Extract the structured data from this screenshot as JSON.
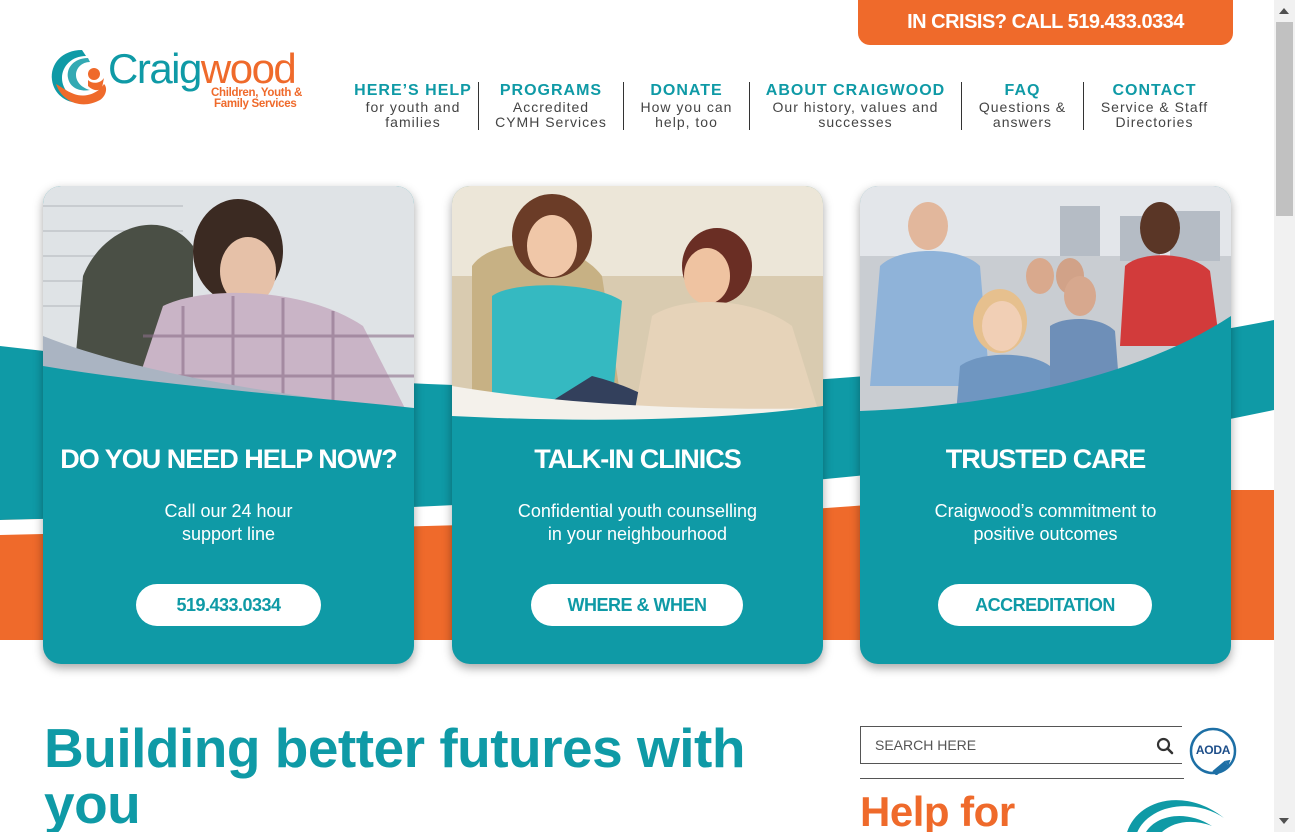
{
  "crisis": {
    "label": "IN CRISIS? CALL 519.433.0334"
  },
  "logo": {
    "word_a": "Craig",
    "word_b": "wood",
    "sub_line1": "Children, Youth &",
    "sub_line2": "Family Services"
  },
  "nav": [
    {
      "title": "HERE’S HELP",
      "sub1": "for youth and",
      "sub2": "families"
    },
    {
      "title": "PROGRAMS",
      "sub1": "Accredited",
      "sub2": "CYMH Services"
    },
    {
      "title": "DONATE",
      "sub1": "How you can",
      "sub2": "help, too"
    },
    {
      "title": "ABOUT CRAIGWOOD",
      "sub1": "Our history, values and",
      "sub2": "successes"
    },
    {
      "title": "FAQ",
      "sub1": "Questions &",
      "sub2": "answers"
    },
    {
      "title": "CONTACT",
      "sub1": "Service & Staff",
      "sub2": "Directories"
    }
  ],
  "cards": [
    {
      "title": "DO YOU NEED HELP NOW?",
      "line1": "Call our 24 hour",
      "line2": "support line",
      "button": "519.433.0334"
    },
    {
      "title": "TALK-IN CLINICS",
      "line1": "Confidential youth counselling",
      "line2": "in your neighbourhood",
      "button": "WHERE & WHEN"
    },
    {
      "title": "TRUSTED CARE",
      "line1": "Craigwood’s commitment to",
      "line2": "positive outcomes",
      "button": "ACCREDITATION"
    }
  ],
  "headline": {
    "line1": "Building better futures with",
    "line2": "you"
  },
  "search": {
    "placeholder": "SEARCH HERE"
  },
  "aoda": {
    "label": "AODA"
  },
  "help": {
    "title": "Help for"
  },
  "colors": {
    "teal": "#0f9aa6",
    "orange": "#ef6a2b"
  }
}
